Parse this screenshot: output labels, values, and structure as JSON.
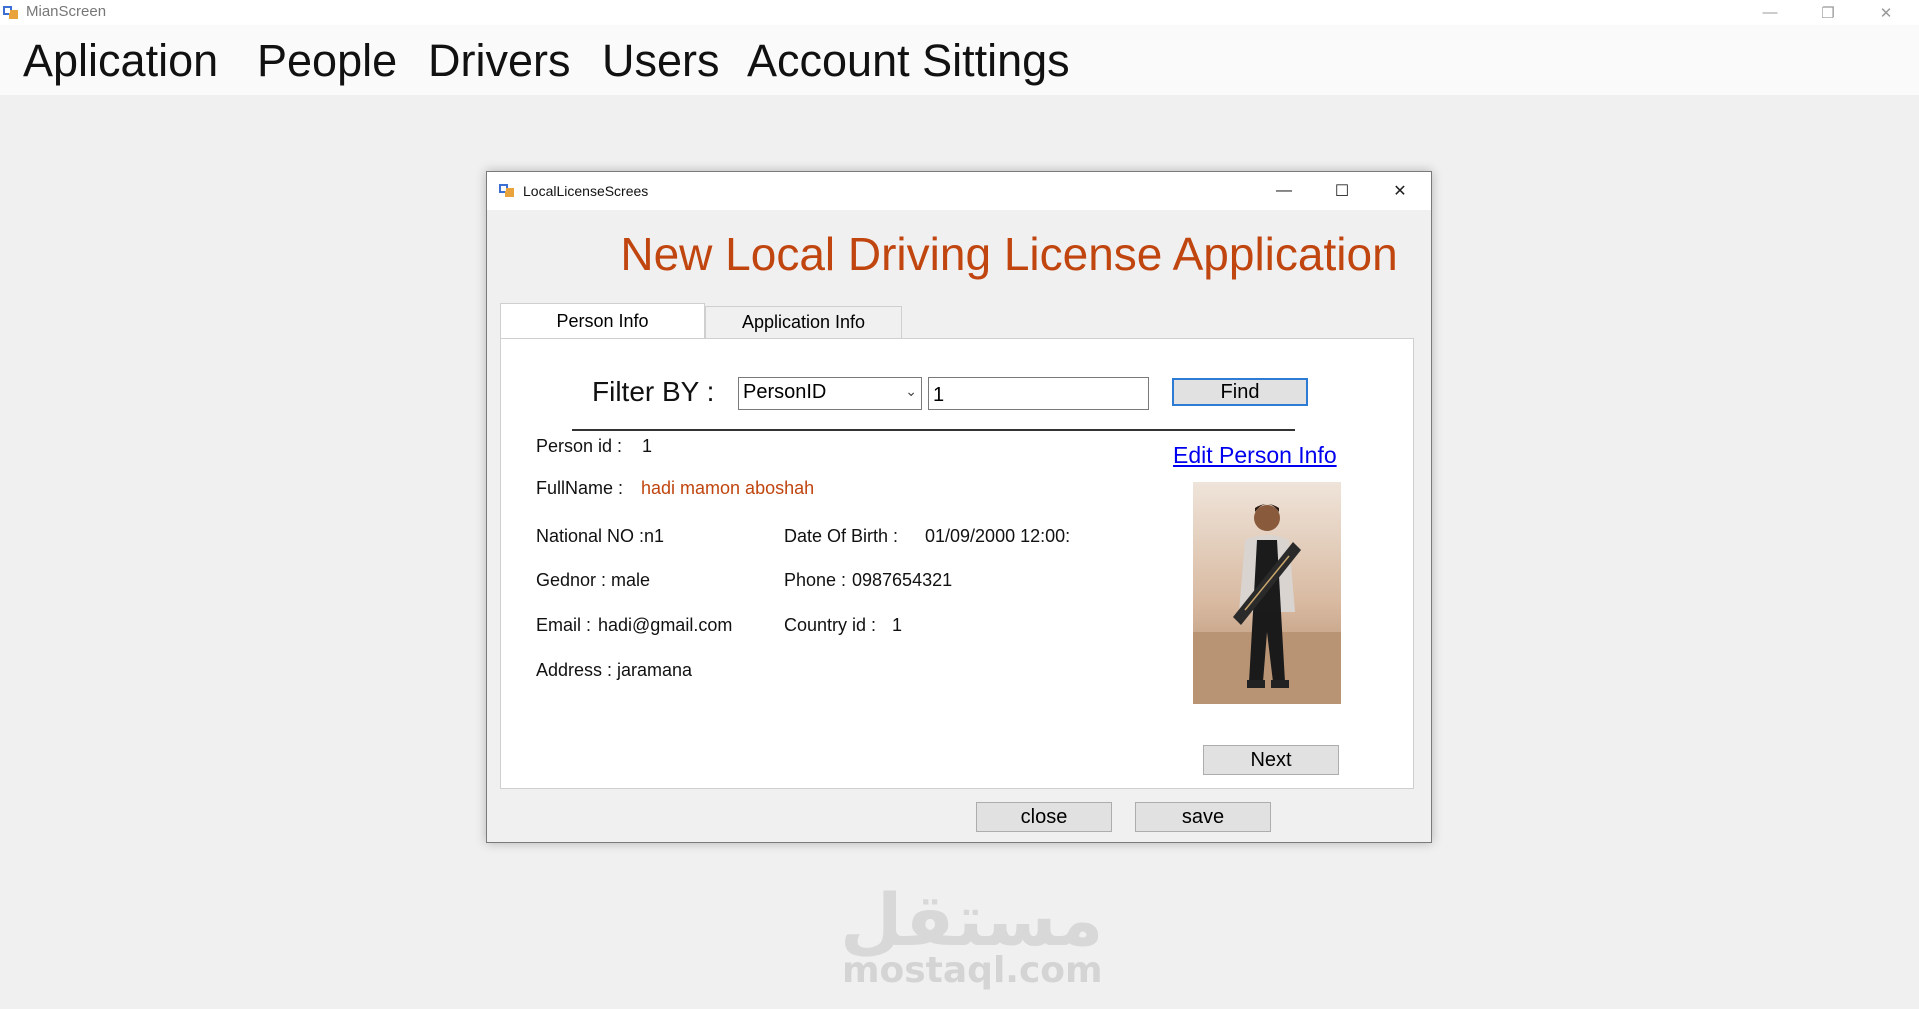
{
  "app": {
    "title": "MianScreen"
  },
  "menu": [
    {
      "label": "Aplication"
    },
    {
      "label": "People"
    },
    {
      "label": "Drivers"
    },
    {
      "label": "Users"
    },
    {
      "label": "Account Sittings"
    }
  ],
  "dialog": {
    "title": "LocalLicenseScrees",
    "heading": "New Local Driving License Application",
    "tabs": [
      {
        "label": "Person Info",
        "active": true
      },
      {
        "label": "Application Info",
        "active": false
      }
    ],
    "filter": {
      "label": "Filter BY :",
      "selected": "PersonID",
      "value": "1",
      "find_label": "Find"
    },
    "edit_link": "Edit Person Info",
    "person": {
      "id_label": "Person id :",
      "id": "1",
      "fullname_label": "FullName :",
      "fullname": "hadi mamon aboshah",
      "national_label": "National NO :",
      "national": "n1",
      "dob_label": "Date Of Birth :",
      "dob": "01/09/2000 12:00:",
      "gender_label": "Gednor :",
      "gender": "male",
      "phone_label": "Phone :",
      "phone": "0987654321",
      "email_label": "Email :",
      "email": "hadi@gmail.com",
      "country_label": "Country id :",
      "country": "1",
      "address_label": "Address :",
      "address": "jaramana"
    },
    "next_label": "Next",
    "close_label": "close",
    "save_label": "save"
  },
  "watermark": {
    "arabic": "مستقل",
    "latin": "mostaql.com"
  },
  "colors": {
    "heading": "#c0450f",
    "link": "#0000ee",
    "focus_border": "#2e7bd6"
  }
}
